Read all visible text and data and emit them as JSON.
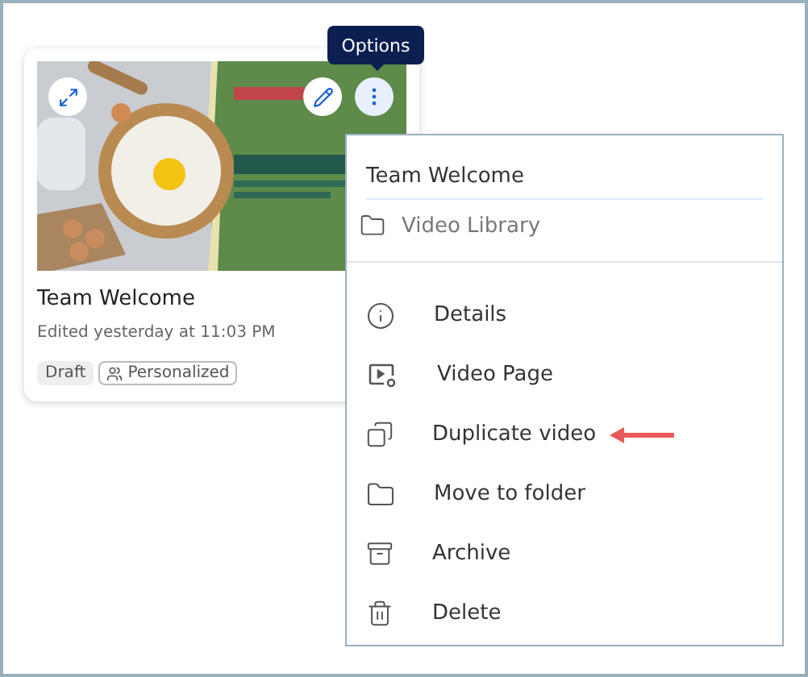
{
  "card": {
    "title": "Team Welcome",
    "edited": "Edited yesterday at 11:03 PM",
    "badges": [
      {
        "label": "Draft",
        "kind": "status"
      },
      {
        "label": "Personalized",
        "kind": "audience"
      }
    ]
  },
  "tooltip": {
    "text": "Options"
  },
  "menu": {
    "title": "Team Welcome",
    "location": "Video Library",
    "items": [
      {
        "label": "Details",
        "pointed": false
      },
      {
        "label": "Video Page",
        "pointed": false
      },
      {
        "label": "Duplicate video",
        "pointed": true
      },
      {
        "label": "Move to folder",
        "pointed": false
      },
      {
        "label": "Archive",
        "pointed": false
      },
      {
        "label": "Delete",
        "pointed": false
      }
    ]
  }
}
